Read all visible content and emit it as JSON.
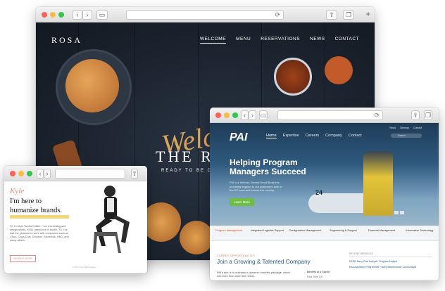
{
  "rosa": {
    "logo": "ROSA",
    "nav": [
      "WELCOME",
      "MENU",
      "RESERVATIONS",
      "NEWS",
      "CONTACT"
    ],
    "welcome_script": "Welcom",
    "title": "THE RO",
    "subtitle": "READY TO BE OP",
    "reload_icon": "⟳"
  },
  "pai": {
    "logo": "PAI",
    "utility": [
      "News",
      "Sitemap",
      "Contact"
    ],
    "search_placeholder": "Search",
    "nav": [
      "Home",
      "Expertise",
      "Careers",
      "Company",
      "Contact"
    ],
    "hero_title": "Helping Program Managers Succeed",
    "hero_text": "PAI is a Veteran-Owned Small Business providing support to our customers both in the DC area and across the country.",
    "cta": "Learn More",
    "tabs": [
      "Program Management",
      "Integrated Logistics Support",
      "Configuration Management",
      "Engineering & Support",
      "Financial Management",
      "Information Technology"
    ],
    "eyebrow": "CAREER OPPORTUNITIES",
    "section_title": "Join a Growing & Talented Company",
    "body_text": "PAI's aim is to maintain a dynamic benefits package, which will more than meet the needs",
    "benefits_label": "Benefits at a Glance",
    "benefits_item": "Paid Time Off",
    "sidebar_heading": "RECENT OPENINGS",
    "openings": [
      "NERD Navy Cost Analyst / Program Analyst",
      "EA Acquisition Programmer / Navy Maintenance Cost Analyst"
    ]
  },
  "portfolio": {
    "signature": "Kyle",
    "headline_1": "I'm here to",
    "headline_2": "humanize brands.",
    "body": "Hi, I'm Kyle Sanford Miller. I run a branding and design studio, KSM, based out of Austin, TX. I've had the pleasure to work with companies such as Cisco, Coca-Cola, Dropbox, Facebook, HBO, and many others.",
    "cta": "VIEW MY WORK",
    "footer": "© 2017 Kyle Miller Design"
  },
  "colors": {
    "rosa_bg": "#1c2430",
    "rosa_gold": "#d9a45a",
    "pai_blue": "#2b5c8a",
    "pai_green": "#6fbe44",
    "pai_orange": "#e14e1b",
    "portfolio_pink": "#e48a8a",
    "portfolio_highlight": "#f5d77b"
  },
  "icons": [
    "back-icon",
    "forward-icon",
    "sidebar-icon",
    "share-icon",
    "tabs-icon",
    "new-tab-icon",
    "reload-icon",
    "search-icon",
    "play-icon"
  ]
}
